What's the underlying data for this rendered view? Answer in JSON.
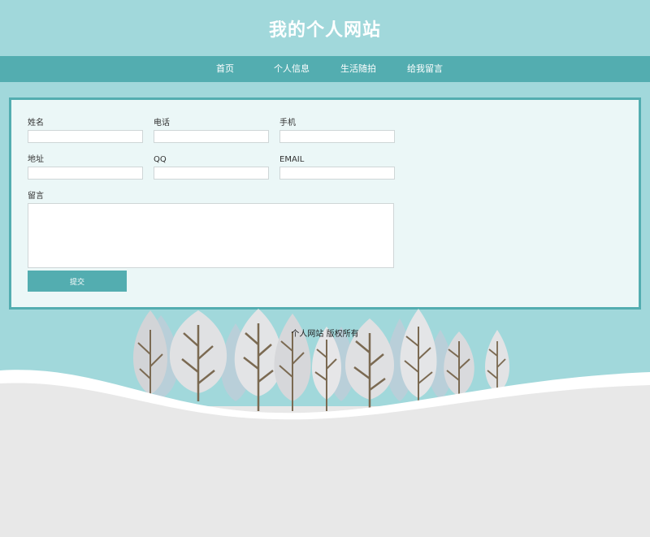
{
  "site": {
    "title": "我的个人网站"
  },
  "nav": {
    "items": [
      {
        "label": "首页"
      },
      {
        "label": "个人信息"
      },
      {
        "label": "生活随拍"
      },
      {
        "label": "给我留言"
      }
    ]
  },
  "form": {
    "name_label": "姓名",
    "phone_label": "电话",
    "mobile_label": "手机",
    "address_label": "地址",
    "qq_label": "QQ",
    "email_label": "EMAIL",
    "message_label": "留言",
    "submit_label": "提交"
  },
  "footer": {
    "text": "个人网站 版权所有"
  },
  "colors": {
    "accent": "#53adb0",
    "sky": "#a1d8db",
    "panel": "#ebf7f7",
    "ground": "#e8e8e8"
  }
}
